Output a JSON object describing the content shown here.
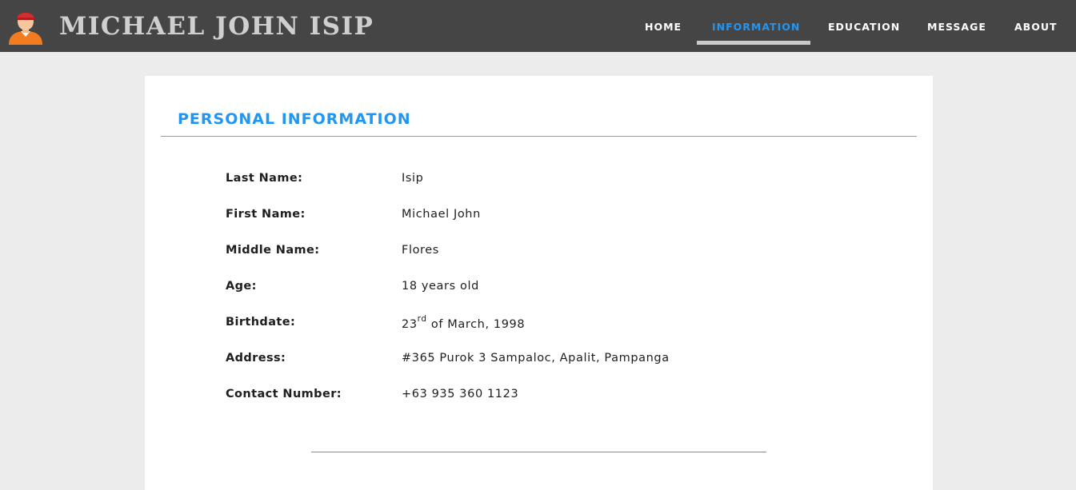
{
  "header": {
    "brand": "MICHAEL JOHN ISIP",
    "nav": [
      {
        "label": "HOME",
        "active": false
      },
      {
        "label": "INFORMATION",
        "active": true
      },
      {
        "label": "EDUCATION",
        "active": false
      },
      {
        "label": "MESSAGE",
        "active": false
      },
      {
        "label": "ABOUT",
        "active": false
      }
    ]
  },
  "colors": {
    "navbar": "#454545",
    "accent": "#2196f3",
    "page_bg": "#ececec",
    "avatar_cap": "#d32f2f",
    "avatar_shirt": "#f47b20"
  },
  "main": {
    "section_title": "PERSONAL INFORMATION",
    "fields": [
      {
        "label": "Last Name:",
        "value": "Isip"
      },
      {
        "label": "First Name:",
        "value": "Michael John"
      },
      {
        "label": "Middle Name:",
        "value": "Flores"
      },
      {
        "label": "Age:",
        "value": "18 years old"
      },
      {
        "label": "Birthdate:",
        "value_day": "23",
        "value_suffix": "rd",
        "value_rest": " of March, 1998"
      },
      {
        "label": "Address:",
        "value": "#365 Purok 3 Sampaloc, Apalit, Pampanga"
      },
      {
        "label": "Contact Number:",
        "value": "+63 935 360 1123"
      }
    ]
  }
}
